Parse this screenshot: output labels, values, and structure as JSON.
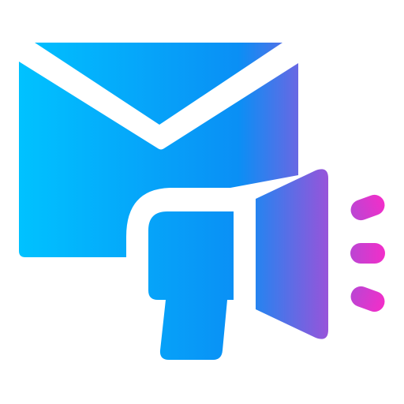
{
  "icon": {
    "name": "email-marketing-megaphone-icon",
    "parts": [
      "envelope-icon",
      "megaphone-icon",
      "sound-waves-icon"
    ]
  },
  "colors": {
    "background": "#ffffff",
    "gradient_start": "#00c2ff",
    "gradient_mid": "#0a8ff5",
    "gradient_end": "#f22ec9",
    "separator": "#ffffff"
  }
}
